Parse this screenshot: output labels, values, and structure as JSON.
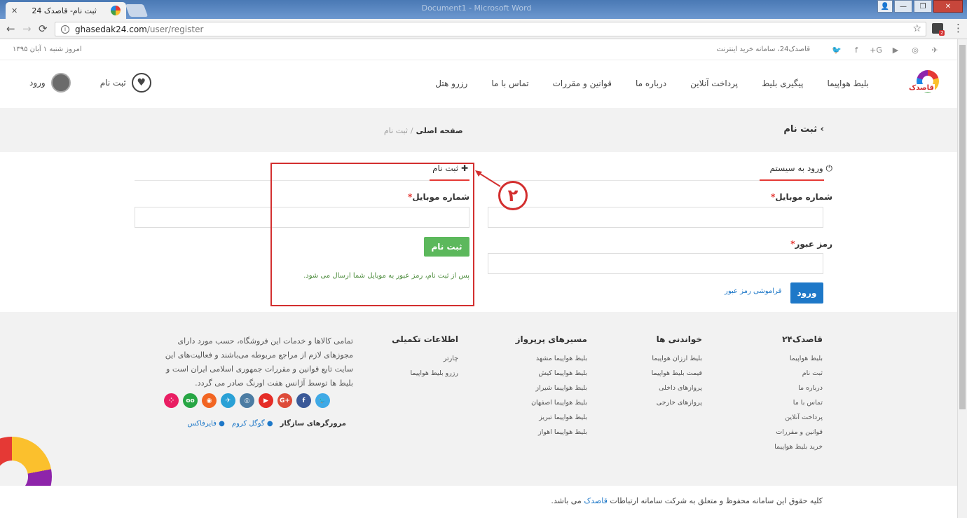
{
  "browser": {
    "tab_title": "ثبت نام- قاصدک 24",
    "tab_close": "✕",
    "window_title": "Document1 - Microsoft Word",
    "url_host": "ghasedak24.com",
    "url_path": "/user/register",
    "ext_badge": "2",
    "back": "←",
    "forward": "→",
    "reload": "⟳",
    "info": "i",
    "star": "☆",
    "menu": "⋮",
    "win_user": "👤",
    "win_min": "—",
    "win_max": "❐",
    "win_close": "✕"
  },
  "topbar": {
    "date": "امروز شنبه ۱ آبان ۱۳۹۵",
    "tagline": "قاصدک24، سامانه خرید اینترنت"
  },
  "social_top": [
    "✈",
    "◎",
    "▶",
    "G+",
    "f",
    "🐦"
  ],
  "header": {
    "logo_word": "قاصدک",
    "nav": [
      "بلیط هواپیما",
      "پیگیری بلیط",
      "پرداخت آنلاین",
      "درباره ما",
      "قوانین و مقررات",
      "تماس با ما",
      "رزرو هتل"
    ],
    "register_label": "ثبت نام",
    "register_icon": "♥",
    "login_label": "ورود"
  },
  "pagebar": {
    "title": "ثبت نام",
    "title_chevron": "›",
    "crumb_home": "صفحه اصلی",
    "crumb_sep": "/",
    "crumb_current": "ثبت نام"
  },
  "login": {
    "title": "ورود به سیستم",
    "title_icon": "⏻",
    "mobile_label": "شماره موبایل",
    "password_label": "رمز عبور",
    "required_mark": "*",
    "submit": "ورود",
    "forgot": "فراموشی رمز عبور"
  },
  "register": {
    "title": "ثبت نام",
    "title_icon": "✚",
    "mobile_label": "شماره موبایل",
    "required_mark": "*",
    "submit": "ثبت نام",
    "note": "پس از ثبت نام، رمز عبور به موبایل شما ارسال می شود."
  },
  "annotation": {
    "number": "۲",
    "color": "#d32f2f"
  },
  "footer": {
    "col1": {
      "title": "قاصدک۲۴",
      "items": [
        "بلیط هواپیما",
        "ثبت نام",
        "درباره ما",
        "تماس با ما",
        "پرداخت آنلاین",
        "قوانین و مقررات",
        "خرید بلیط هواپیما"
      ]
    },
    "col2": {
      "title": "خواندنی ها",
      "items": [
        "بلیط ارزان هواپیما",
        "قیمت بلیط هواپیما",
        "پروازهای داخلی",
        "پروازهای خارجی"
      ]
    },
    "col3": {
      "title": "مسیرهای پرپرواز",
      "items": [
        "بلیط هواپیما مشهد",
        "بلیط هواپیما کیش",
        "بلیط هواپیما شیراز",
        "بلیط هواپیما اصفهان",
        "بلیط هواپیما تبریز",
        "بلیط هواپیما اهواز"
      ]
    },
    "col4": {
      "title": "اطلاعات تکمیلی",
      "items": [
        "چارتر",
        "رزرو بلیط هواپیما"
      ]
    },
    "about": "تمامی کالاها و خدمات این فروشگاه، حسب مورد دارای مجوزهای لازم از مراجع مربوطه می‌باشند و فعالیت‌های این سایت تابع قوانین و مقررات جمهوری اسلامی ایران است و بلیط ها توسط آژانس هفت اورنگ صادر می گردد.",
    "social": [
      {
        "icon": "🐦",
        "color": "#3fa9e6"
      },
      {
        "icon": "f",
        "color": "#3b5998"
      },
      {
        "icon": "G+",
        "color": "#dd4b39"
      },
      {
        "icon": "▶",
        "color": "#e52d27"
      },
      {
        "icon": "◎",
        "color": "#4c7ca3"
      },
      {
        "icon": "✈",
        "color": "#2aa1d6"
      },
      {
        "icon": "◉",
        "color": "#f26522"
      },
      {
        "icon": "oo",
        "color": "#27a644"
      },
      {
        "icon": "⁘",
        "color": "#e91e63"
      }
    ],
    "browsers_label": "مرورگرهای سازگار",
    "browser_chrome": "گوگل کروم",
    "browser_firefox": "فایرفاکس",
    "browser_icon": "●"
  },
  "copyright": {
    "before": "کلیه حقوق این سامانه محفوظ و متعلق به شرکت سامانه ارتباطات",
    "link": "قاصدک",
    "after": "می باشد."
  }
}
